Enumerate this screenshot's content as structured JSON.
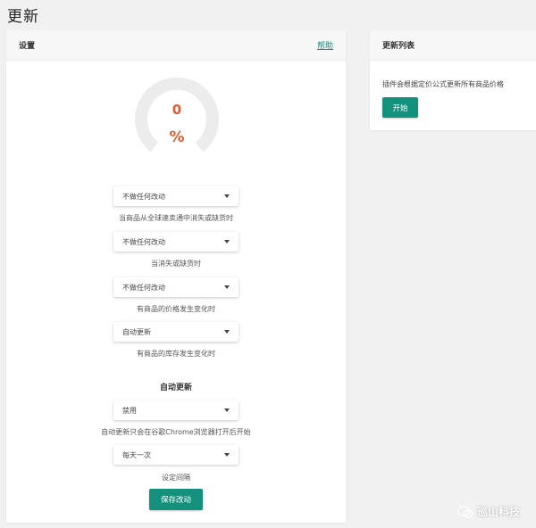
{
  "page": {
    "title": "更新"
  },
  "settings": {
    "header": "设置",
    "help": "帮助",
    "gauge": {
      "value": "0",
      "unit": "%",
      "progress": 0
    },
    "rules": [
      {
        "selected": "不做任何改动",
        "caption": "当商品从全球速卖通中消失或缺货时"
      },
      {
        "selected": "不做任何改动",
        "caption": "当消失或缺货时"
      },
      {
        "selected": "不做任何改动",
        "caption": "有商品的价格发生变化时"
      },
      {
        "selected": "自动更新",
        "caption": "有商品的库存发生变化时"
      }
    ],
    "auto_update": {
      "title": "自动更新",
      "mode_selected": "禁用",
      "mode_caption": "自动更新只会在谷歌Chrome浏览器打开后开始",
      "interval_selected": "每天一次",
      "interval_caption": "设定间隔"
    },
    "save_label": "保存改动"
  },
  "update_list": {
    "header": "更新列表",
    "description": "插件会根据定价公式更新所有商品价格",
    "start_label": "开始"
  },
  "watermark": {
    "text": "巡山科技",
    "icon": "wechat-icon"
  },
  "colors": {
    "accent": "#14917d",
    "gauge_value": "#e05b2b",
    "gauge_track": "#ececec"
  }
}
